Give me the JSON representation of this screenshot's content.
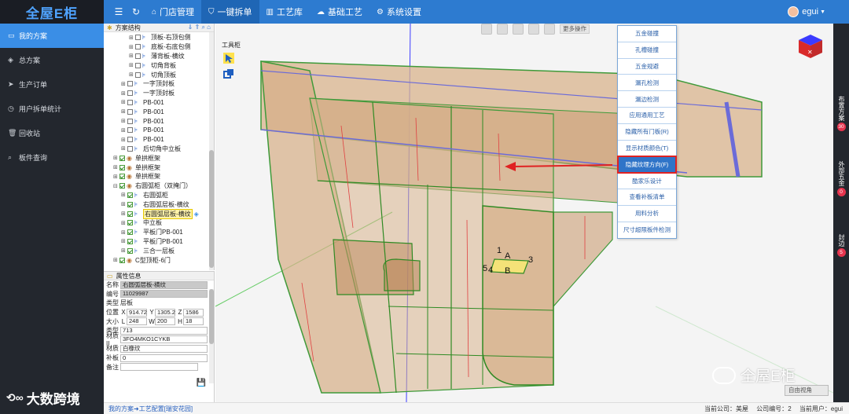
{
  "app": {
    "logo": "全屋E柜"
  },
  "topnav": {
    "items": [
      {
        "label": "门店管理"
      },
      {
        "label": "一键拆单"
      },
      {
        "label": "工艺库"
      },
      {
        "label": "基础工艺"
      },
      {
        "label": "系统设置"
      }
    ],
    "user": "egui"
  },
  "sidebar": {
    "items": [
      {
        "label": "我的方案"
      },
      {
        "label": "总方案"
      },
      {
        "label": "生产订单"
      },
      {
        "label": "用户拆单统计"
      },
      {
        "label": "回收站"
      },
      {
        "label": "板件查询"
      }
    ]
  },
  "tree": {
    "title": "方案结构",
    "rows": [
      {
        "label": "顶板-右顶包侧"
      },
      {
        "label": "底板-右底包侧"
      },
      {
        "label": "薄背板-横纹"
      },
      {
        "label": "切角背板"
      },
      {
        "label": "切角顶板"
      },
      {
        "label": "一字顶封板"
      },
      {
        "label": "一字顶封板"
      },
      {
        "label": "PB-001"
      },
      {
        "label": "PB-001"
      },
      {
        "label": "PB-001"
      },
      {
        "label": "PB-001"
      },
      {
        "label": "PB-001"
      },
      {
        "label": "后切角中立板"
      },
      {
        "label": "单拱框架"
      },
      {
        "label": "单拱框架"
      },
      {
        "label": "单拱框架"
      },
      {
        "label": "右圆弧柜（双掩门）"
      },
      {
        "label": "右圆弧柜"
      },
      {
        "label": "右圆弧层板-横纹"
      },
      {
        "label": "右圆弧层板-横纹"
      },
      {
        "label": "中立板"
      },
      {
        "label": "平板门PB-001"
      },
      {
        "label": "平板门PB-001"
      },
      {
        "label": "三合一层板"
      },
      {
        "label": "C型顶柜-6门"
      }
    ]
  },
  "properties": {
    "title": "属性信息",
    "name_label": "名称",
    "name": "右圆弧层板-横纹",
    "id_label": "编号",
    "id": "11029987",
    "type_label": "类型",
    "type": "层板",
    "pos_label": "位置",
    "x": "914.72",
    "y": "1305.2",
    "z": "1586",
    "size_label": "大小",
    "l": "248",
    "w": "200",
    "h": "18",
    "type2_label": "类型",
    "type2": "713",
    "mat_code_label": "材质II",
    "mat_code": "3FO4MKO1CYKB",
    "mat_label": "材质",
    "mat": "白橡纹",
    "edge_label": "补板",
    "edge": "0",
    "note_label": "备注",
    "note": ""
  },
  "viewport": {
    "toolbox_label": "工具柜",
    "more_label": "更多操作",
    "view_select": "自由视角",
    "labels": {
      "a": "A",
      "b": "B",
      "n1": "1",
      "n3": "3",
      "n5": "5",
      "n4": "4"
    }
  },
  "context_menu": {
    "items": [
      {
        "label": "五金碰撞"
      },
      {
        "label": "孔槽碰撞"
      },
      {
        "label": "五金规避"
      },
      {
        "label": "漏孔检测"
      },
      {
        "label": "漏边检测"
      },
      {
        "label": "应用通用工艺"
      },
      {
        "label": "隐藏所有门板(R)"
      },
      {
        "label": "显示材质颜色(T)"
      },
      {
        "label": "隐藏纹理方向(F)"
      },
      {
        "label": "酷家乐设计"
      },
      {
        "label": "查看补板清单"
      },
      {
        "label": "用料分析"
      },
      {
        "label": "尺寸超限板件检测"
      }
    ]
  },
  "rightstrip": {
    "items": [
      {
        "label": "布置方案",
        "badge": "30"
      },
      {
        "label": "外部五金",
        "badge": "0"
      },
      {
        "label": "封边",
        "badge": "5"
      }
    ]
  },
  "status": {
    "crumb": "我的方案➜工艺配置[瑞安花园]",
    "company_label": "当前公司：",
    "company": "美屋",
    "company_no_label": "公司编号：",
    "company_no": "2",
    "user_label": "当前用户：",
    "user": "egui"
  },
  "watermark": {
    "left": "大数跨境",
    "right": "全屋E柜"
  },
  "colors": {
    "header": "#2d7bd0",
    "sidebar": "#23272e",
    "accent": "#3a8ee6",
    "panel_wood": "#c9a07a",
    "edge_green": "#3c9a3a",
    "arrow_red": "#e02222"
  }
}
